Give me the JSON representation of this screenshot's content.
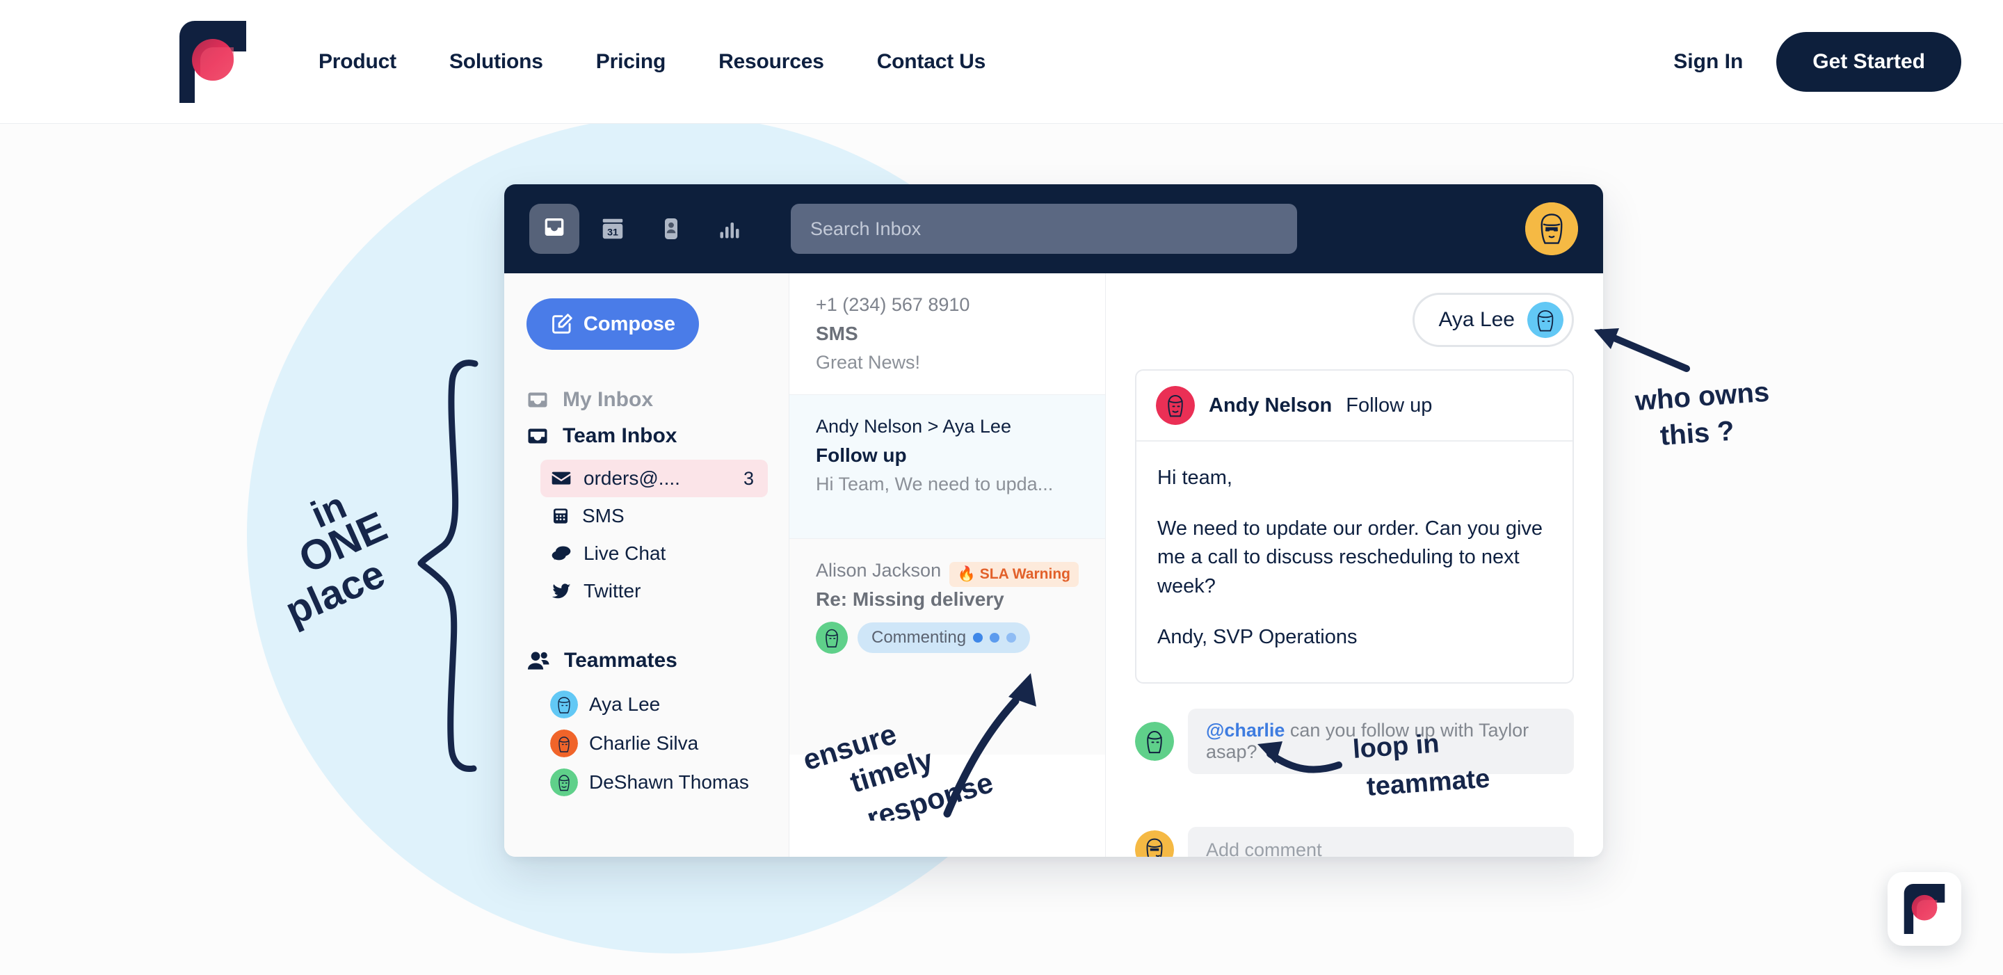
{
  "header": {
    "logo_name": "front-logo",
    "nav": [
      {
        "label": "Product"
      },
      {
        "label": "Solutions"
      },
      {
        "label": "Pricing"
      },
      {
        "label": "Resources"
      },
      {
        "label": "Contact Us"
      }
    ],
    "sign_in": "Sign In",
    "get_started": "Get Started"
  },
  "app": {
    "topbar": {
      "icons": [
        "inbox-icon",
        "calendar-icon",
        "contacts-icon",
        "analytics-icon"
      ],
      "calendar_day": "31",
      "search_placeholder": "Search Inbox",
      "search_value": "",
      "avatar_name": "user-avatar"
    },
    "sidebar": {
      "compose_label": "Compose",
      "my_inbox": "My Inbox",
      "team_inbox": "Team Inbox",
      "channels": [
        {
          "label": "orders@....",
          "icon": "envelope-icon",
          "badge": "3",
          "selected": true
        },
        {
          "label": "SMS",
          "icon": "sms-icon",
          "badge": "",
          "selected": false
        },
        {
          "label": "Live Chat",
          "icon": "chat-icon",
          "badge": "",
          "selected": false
        },
        {
          "label": "Twitter",
          "icon": "twitter-icon",
          "badge": "",
          "selected": false
        }
      ],
      "teammates_label": "Teammates",
      "teammates": [
        {
          "name": "Aya Lee",
          "color": "#62c8f5"
        },
        {
          "name": "Charlie Silva",
          "color": "#f0642a"
        },
        {
          "name": "DeShawn Thomas",
          "color": "#5fd08a"
        }
      ]
    },
    "conversations": [
      {
        "from": "+1 (234) 567 8910",
        "subject": "SMS",
        "preview": "Great News!",
        "state": "plain",
        "badge": "",
        "commenting": ""
      },
      {
        "from": "Andy Nelson > Aya Lee",
        "subject": "Follow up",
        "preview": "Hi Team, We need to upda...",
        "state": "selected",
        "badge": "",
        "commenting": ""
      },
      {
        "from": "Alison Jackson",
        "subject": "Re: Missing delivery",
        "preview": "",
        "state": "tinted",
        "badge": "SLA Warning",
        "badge_icon": "fire-icon",
        "commenting": "Commenting"
      }
    ],
    "detail": {
      "assignee": "Aya Lee",
      "message": {
        "sender": "Andy Nelson",
        "subject": "Follow up",
        "paragraphs": [
          "Hi team,",
          "We need to update our order. Can you give me a call to discuss rescheduling to next week?",
          "Andy, SVP Operations"
        ]
      },
      "comment": {
        "mention": "@charlie",
        "text": " can you follow up with Taylor asap?"
      },
      "add_comment_placeholder": "Add comment"
    }
  },
  "annotations": [
    {
      "id": "in-one-place",
      "lines": [
        "in",
        "ONE",
        "place"
      ]
    },
    {
      "id": "who-owns-this",
      "lines": [
        "who owns",
        "this ?"
      ]
    },
    {
      "id": "ensure-timely-response",
      "lines": [
        "ensure",
        "timely",
        "response"
      ]
    },
    {
      "id": "loop-in-teammate",
      "lines": [
        "loop in",
        "teammate"
      ]
    }
  ],
  "chat_widget": {
    "icon": "front-logo-icon"
  },
  "colors": {
    "brand_navy": "#0d1f3c",
    "brand_pink": "#e8305a",
    "accent_blue": "#4a7ce8",
    "blob_blue": "#d9f0fa",
    "selected_pink": "#fbe4e8",
    "sla_orange": "#e2602a"
  }
}
